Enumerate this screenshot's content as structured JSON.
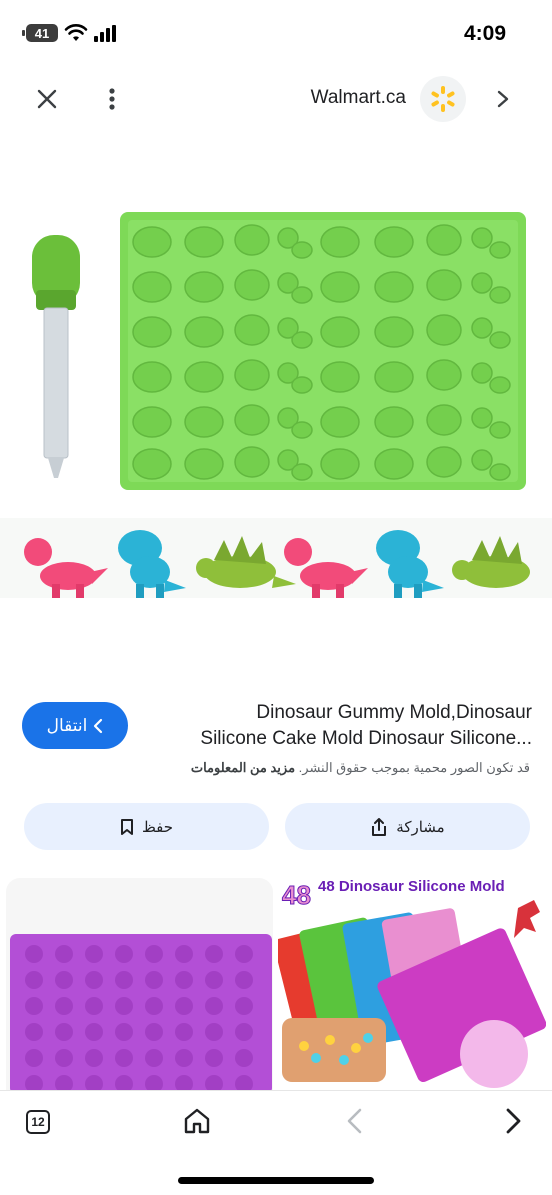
{
  "status_bar": {
    "battery": "41",
    "time": "4:09"
  },
  "top_bar": {
    "site_name": "Walmart.ca",
    "close_icon": "close-icon",
    "more_icon": "more-vert-icon",
    "next_icon": "chevron-right-icon"
  },
  "main_image": {
    "description_icon": "product-image",
    "colors": {
      "mold_green": "#7ed957",
      "dropper_green": "#6bbf3a",
      "gummy_pink": "#f24b7a",
      "gummy_blue": "#2bb3d6",
      "gummy_olive": "#8fbf3a"
    }
  },
  "result": {
    "visit_label": "انتقال",
    "title_line1": "Dinosaur Gummy Mold,Dinosaur",
    "title_line2": "Silicone Cake Mold Dinosaur Silicone...",
    "notice_text": "قد تكون الصور محمية بموجب حقوق النشر.",
    "notice_link": "مزيد من المعلومات"
  },
  "actions": {
    "save_label": "حفظ",
    "share_label": "مشاركة"
  },
  "related": {
    "item2_title": "48 Dinosaur Silicone Mold",
    "colors": {
      "purple": "#b34fd6",
      "red": "#e63b2e",
      "green": "#5ac43d",
      "blue": "#2e9fe0",
      "pink": "#e98fd0",
      "magenta": "#cc3cc3"
    }
  },
  "bottom_bar": {
    "tab_count": "12"
  },
  "accent": "#1a73e8"
}
